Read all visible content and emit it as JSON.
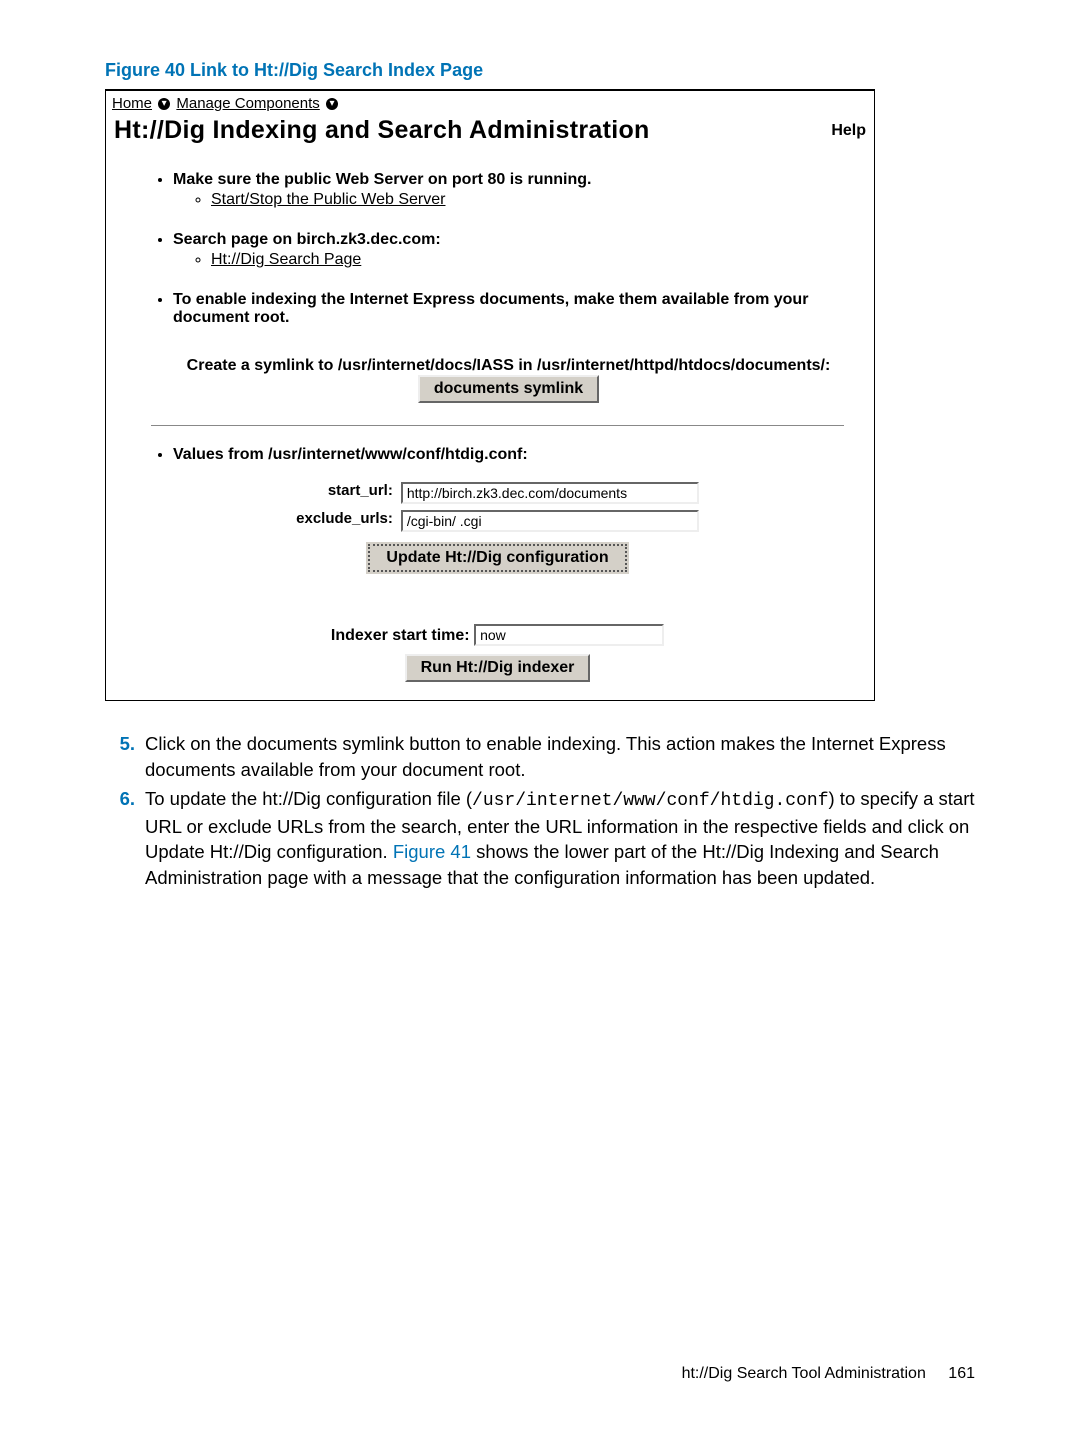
{
  "figure_caption": "Figure 40 Link to Ht://Dig Search Index Page",
  "breadcrumb": {
    "home": "Home",
    "manage": "Manage Components"
  },
  "admin_title": "Ht://Dig Indexing and Search Administration",
  "help_label": "Help",
  "bullet1": {
    "text": "Make sure the public Web Server on port 80 is running.",
    "sub": "Start/Stop the Public Web Server"
  },
  "bullet2": {
    "text": "Search page on birch.zk3.dec.com:",
    "sub": "Ht://Dig Search Page"
  },
  "bullet3": {
    "text": "To enable indexing the Internet Express documents, make them available from your document root."
  },
  "symlink": {
    "desc": "Create a symlink to /usr/internet/docs/IASS in /usr/internet/httpd/htdocs/documents/:",
    "button": "documents symlink"
  },
  "bullet4": {
    "text": "Values from /usr/internet/www/conf/htdig.conf:"
  },
  "form": {
    "start_url_label": "start_url:",
    "start_url_value": "http://birch.zk3.dec.com/documents",
    "exclude_label": "exclude_urls:",
    "exclude_value": "/cgi-bin/ .cgi",
    "update_button": "Update Ht://Dig configuration",
    "indexer_label": "Indexer start time:",
    "indexer_value": "now",
    "run_button": "Run Ht://Dig indexer"
  },
  "instructions": {
    "item5_num": "5.",
    "item5_text": "Click on the documents symlink button to enable indexing. This action makes the Internet Express documents available from your document root.",
    "item6_num": "6.",
    "item6_a": "To update the ht://Dig configuration file (",
    "item6_code": "/usr/internet/www/conf/htdig.conf",
    "item6_b": ") to specify a start URL or exclude URLs from the search, enter the URL information in the respective fields and click on Update Ht://Dig configuration. ",
    "item6_link": "Figure 41",
    "item6_c": " shows the lower part of the Ht://Dig Indexing and Search Administration page with a message that the configuration information has been updated."
  },
  "footer": {
    "text": "ht://Dig Search Tool Administration",
    "page": "161"
  }
}
